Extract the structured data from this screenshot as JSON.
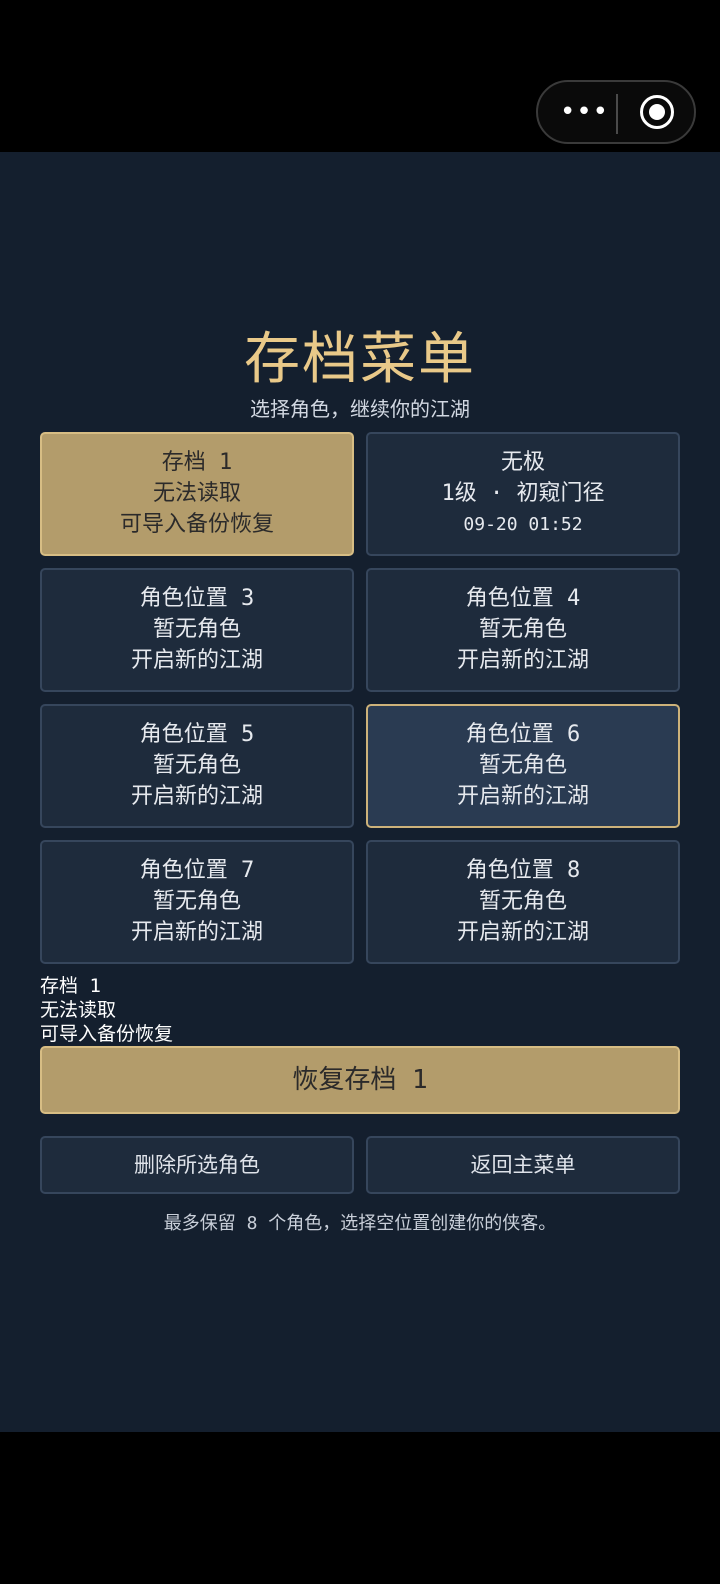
{
  "capsule": {
    "more_label": "•••"
  },
  "header": {
    "title": "存档菜单",
    "subtitle": "选择角色，继续你的江湖"
  },
  "slots": [
    {
      "line1": "存档 1",
      "line2": "无法读取",
      "line3": "可导入备份恢复",
      "state": "selected"
    },
    {
      "line1": "无极",
      "line2": "1级 · 初窥门径",
      "line3": "09-20 01:52",
      "state": "normal"
    },
    {
      "line1": "角色位置 3",
      "line2": "暂无角色",
      "line3": "开启新的江湖",
      "state": "normal"
    },
    {
      "line1": "角色位置 4",
      "line2": "暂无角色",
      "line3": "开启新的江湖",
      "state": "normal"
    },
    {
      "line1": "角色位置 5",
      "line2": "暂无角色",
      "line3": "开启新的江湖",
      "state": "normal"
    },
    {
      "line1": "角色位置 6",
      "line2": "暂无角色",
      "line3": "开启新的江湖",
      "state": "highlight"
    },
    {
      "line1": "角色位置 7",
      "line2": "暂无角色",
      "line3": "开启新的江湖",
      "state": "normal"
    },
    {
      "line1": "角色位置 8",
      "line2": "暂无角色",
      "line3": "开启新的江湖",
      "state": "normal"
    }
  ],
  "status": {
    "line1": "存档 1",
    "line2": "无法读取",
    "line3": "可导入备份恢复"
  },
  "actions": {
    "restore_label": "恢复存档 1",
    "delete_label": "删除所选角色",
    "back_label": "返回主菜单"
  },
  "footnote": "最多保留 8 个角色，选择空位置创建你的侠客。",
  "colors": {
    "background": "#141f2e",
    "accent_gold": "#b39c6b",
    "title_gold": "#e9c989",
    "card": "#1e2b3c",
    "card_highlight": "#2a3b52"
  }
}
